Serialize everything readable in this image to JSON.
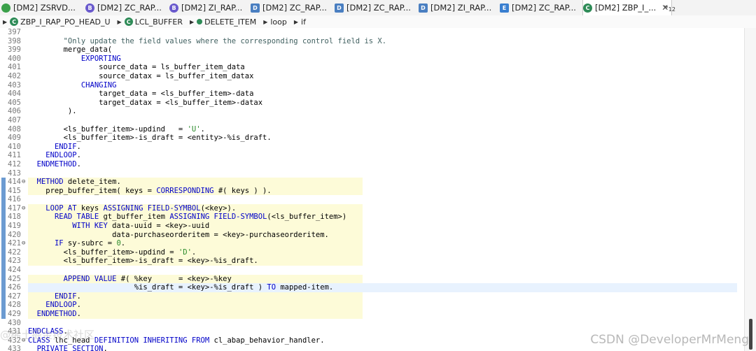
{
  "tabs": [
    {
      "label": "[DM2] ZSRVD...",
      "icon": "service-definition-icon",
      "icon_text": "",
      "color": "#3aa04a"
    },
    {
      "label": "[DM2] ZC_RAP...",
      "icon": "behavior-definition-icon",
      "icon_text": "B",
      "color": "#6a5acd"
    },
    {
      "label": "[DM2] ZI_RAP...",
      "icon": "behavior-definition-icon",
      "icon_text": "B",
      "color": "#6a5acd"
    },
    {
      "label": "[DM2] ZC_RAP...",
      "icon": "data-definition-icon",
      "icon_text": "D",
      "color": "#4a7fc1"
    },
    {
      "label": "[DM2] ZC_RAP...",
      "icon": "data-definition-icon",
      "icon_text": "D",
      "color": "#4a7fc1"
    },
    {
      "label": "[DM2] ZI_RAP...",
      "icon": "data-definition-icon",
      "icon_text": "D",
      "color": "#4a7fc1"
    },
    {
      "label": "[DM2] ZC_RAP...",
      "icon": "metadata-extension-icon",
      "icon_text": "E",
      "color": "#3a7fd0"
    },
    {
      "label": "[DM2] ZBP_I_...",
      "icon": "abap-class-icon",
      "icon_text": "C",
      "color": "#2e8b57",
      "active": true
    }
  ],
  "overflow": {
    "symbol": "»",
    "count": "12"
  },
  "breadcrumb": [
    {
      "label": "ZBP_I_RAP_PO_HEAD_U",
      "icon": "abap-class-icon"
    },
    {
      "label": "LCL_BUFFER",
      "icon": "local-class-icon"
    },
    {
      "label": "DELETE_ITEM",
      "icon": "method-icon"
    },
    {
      "label": "loop",
      "icon": ""
    },
    {
      "label": "if",
      "icon": ""
    }
  ],
  "code_lines": [
    {
      "n": "397",
      "t": [
        [
          "",
          ""
        ]
      ]
    },
    {
      "n": "398",
      "t": [
        [
          "",
          "        "
        ],
        [
          "cm",
          "\"Only update the field values where the corresponding control field is X."
        ]
      ]
    },
    {
      "n": "399",
      "t": [
        [
          "",
          "        merge_data("
        ]
      ]
    },
    {
      "n": "400",
      "t": [
        [
          "",
          "            "
        ],
        [
          "kw",
          "EXPORTING"
        ]
      ]
    },
    {
      "n": "401",
      "t": [
        [
          "",
          "                source_data = ls_buffer_item_data"
        ]
      ]
    },
    {
      "n": "402",
      "t": [
        [
          "",
          "                source_datax = ls_buffer_item_datax"
        ]
      ]
    },
    {
      "n": "403",
      "t": [
        [
          "",
          "            "
        ],
        [
          "kw",
          "CHANGING"
        ]
      ]
    },
    {
      "n": "404",
      "t": [
        [
          "",
          "                target_data = <ls_buffer_item>-data"
        ]
      ]
    },
    {
      "n": "405",
      "t": [
        [
          "",
          "                target_datax = <ls_buffer_item>-datax"
        ]
      ]
    },
    {
      "n": "406",
      "t": [
        [
          "",
          "         )."
        ]
      ]
    },
    {
      "n": "407",
      "t": [
        [
          "",
          ""
        ]
      ]
    },
    {
      "n": "408",
      "t": [
        [
          "",
          "        <ls_buffer_item>-updind   = "
        ],
        [
          "st",
          "'U'"
        ],
        [
          "",
          "."
        ]
      ]
    },
    {
      "n": "409",
      "t": [
        [
          "",
          "        <ls_buffer_item>-is_draft = <entity>-%is_draft."
        ]
      ]
    },
    {
      "n": "410",
      "t": [
        [
          "",
          "      "
        ],
        [
          "kw",
          "ENDIF"
        ],
        [
          "",
          "."
        ]
      ]
    },
    {
      "n": "411",
      "t": [
        [
          "",
          "    "
        ],
        [
          "kw",
          "ENDLOOP"
        ],
        [
          "",
          "."
        ]
      ]
    },
    {
      "n": "412",
      "t": [
        [
          "",
          "  "
        ],
        [
          "kw",
          "ENDMETHOD"
        ],
        [
          "",
          "."
        ]
      ]
    },
    {
      "n": "413",
      "t": [
        [
          "",
          ""
        ]
      ]
    },
    {
      "n": "414",
      "fold": "⊖",
      "hl": true,
      "bar": true,
      "t": [
        [
          "",
          "  "
        ],
        [
          "kw",
          "METHOD"
        ],
        [
          "",
          " delete_item."
        ]
      ]
    },
    {
      "n": "415",
      "hl": true,
      "bar": true,
      "t": [
        [
          "",
          "    prep_buffer_item( keys = "
        ],
        [
          "kw",
          "CORRESPONDING"
        ],
        [
          "",
          " #( keys ) )."
        ]
      ]
    },
    {
      "n": "416",
      "hl": true,
      "bar": true,
      "t": [
        [
          "",
          ""
        ]
      ]
    },
    {
      "n": "417",
      "fold": "⊖",
      "hl": true,
      "bar": true,
      "t": [
        [
          "",
          "    "
        ],
        [
          "kw",
          "LOOP AT"
        ],
        [
          "",
          " keys "
        ],
        [
          "kw",
          "ASSIGNING FIELD-SYMBOL"
        ],
        [
          "",
          "(<key>)."
        ]
      ]
    },
    {
      "n": "418",
      "hl": true,
      "bar": true,
      "t": [
        [
          "",
          "      "
        ],
        [
          "kw",
          "READ TABLE"
        ],
        [
          "",
          " gt_buffer_item "
        ],
        [
          "kw",
          "ASSIGNING FIELD-SYMBOL"
        ],
        [
          "",
          "(<ls_buffer_item>)"
        ]
      ]
    },
    {
      "n": "419",
      "hl": true,
      "bar": true,
      "t": [
        [
          "",
          "          "
        ],
        [
          "kw",
          "WITH KEY"
        ],
        [
          "",
          " data-uuid = <key>-uuid"
        ]
      ]
    },
    {
      "n": "420",
      "hl": true,
      "bar": true,
      "t": [
        [
          "",
          "                   data-purchaseorderitem = <key>-purchaseorderitem."
        ]
      ]
    },
    {
      "n": "421",
      "fold": "⊖",
      "hl": true,
      "bar": true,
      "t": [
        [
          "",
          "      "
        ],
        [
          "kw",
          "IF"
        ],
        [
          "",
          " sy-subrc = "
        ],
        [
          "nm",
          "0"
        ],
        [
          "",
          "."
        ]
      ]
    },
    {
      "n": "422",
      "hl": true,
      "bar": true,
      "t": [
        [
          "",
          "        <ls_buffer_item>-updind = "
        ],
        [
          "st",
          "'D'"
        ],
        [
          "",
          "."
        ]
      ]
    },
    {
      "n": "423",
      "hl": true,
      "bar": true,
      "t": [
        [
          "",
          "        <ls_buffer_item>-is_draft = <key>-%is_draft."
        ]
      ]
    },
    {
      "n": "424",
      "hl": true,
      "bar": true,
      "t": [
        [
          "",
          ""
        ]
      ]
    },
    {
      "n": "425",
      "hl": true,
      "bar": true,
      "t": [
        [
          "",
          "        "
        ],
        [
          "kw",
          "APPEND VALUE"
        ],
        [
          "",
          " #( %key      = <key>-%key"
        ]
      ]
    },
    {
      "n": "426",
      "hl": true,
      "cur": true,
      "bar": true,
      "t": [
        [
          "",
          "                        %is_draft = <key>-%is_draft ) "
        ],
        [
          "kw",
          "TO"
        ],
        [
          "",
          " mapped-item."
        ]
      ]
    },
    {
      "n": "427",
      "hl": true,
      "bar": true,
      "t": [
        [
          "",
          "      "
        ],
        [
          "kw",
          "ENDIF"
        ],
        [
          "",
          "."
        ]
      ]
    },
    {
      "n": "428",
      "hl": true,
      "bar": true,
      "t": [
        [
          "",
          "    "
        ],
        [
          "kw",
          "ENDLOOP"
        ],
        [
          "",
          "."
        ]
      ]
    },
    {
      "n": "429",
      "hl": true,
      "bar": true,
      "t": [
        [
          "",
          "  "
        ],
        [
          "kw",
          "ENDMETHOD"
        ],
        [
          "",
          "."
        ]
      ]
    },
    {
      "n": "430",
      "t": [
        [
          "",
          ""
        ]
      ]
    },
    {
      "n": "431",
      "t": [
        [
          "kw",
          "ENDCLASS"
        ],
        [
          "",
          "."
        ]
      ]
    },
    {
      "n": "432",
      "fold": "⊖",
      "t": [
        [
          "kw",
          "CLASS"
        ],
        [
          "",
          " lhc_head "
        ],
        [
          "kw",
          "DEFINITION INHERITING FROM"
        ],
        [
          "",
          " cl_abap_behavior_handler."
        ]
      ]
    },
    {
      "n": "433",
      "t": [
        [
          "",
          "  "
        ],
        [
          "kw",
          "PRIVATE SECTION"
        ],
        [
          "",
          "."
        ]
      ]
    }
  ],
  "watermark": "CSDN @DeveloperMrMeng",
  "watermark_left": "@稀土掘金技术社区"
}
